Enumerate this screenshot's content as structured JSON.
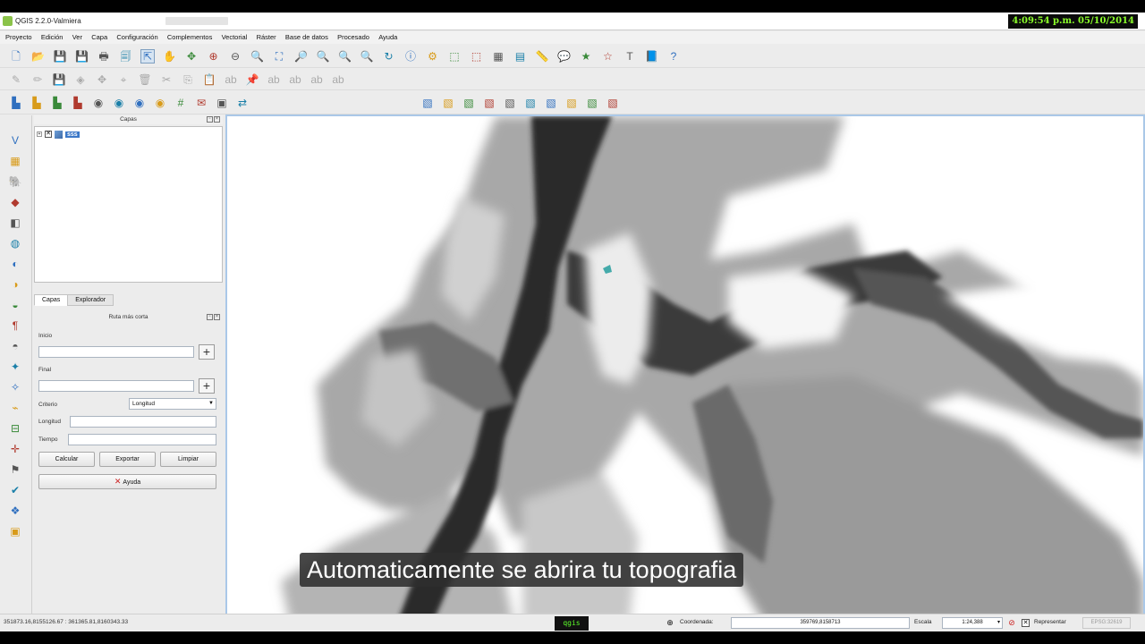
{
  "clock": "4:09:54 p.m. 05/10/2014",
  "window": {
    "title": "QGIS 2.2.0-Valmiera"
  },
  "menu": [
    "Proyecto",
    "Edición",
    "Ver",
    "Capa",
    "Configuración",
    "Complementos",
    "Vectorial",
    "Ráster",
    "Base de datos",
    "Procesado",
    "Ayuda"
  ],
  "layers_panel": {
    "title": "Capas",
    "layers": [
      {
        "name": "sss",
        "visible": true
      }
    ]
  },
  "tabs": [
    {
      "label": "Capas",
      "active": true
    },
    {
      "label": "Explorador",
      "active": false
    }
  ],
  "route_panel": {
    "title": "Ruta más corta",
    "start_label": "Inicio",
    "end_label": "Final",
    "criterion_label": "Criterio",
    "criterion_value": "Longitud",
    "length_label": "Longitud",
    "time_label": "Tiempo",
    "calculate": "Calcular",
    "export": "Exportar",
    "clear": "Limpiar",
    "help": "Ayuda"
  },
  "subtitle": "Automaticamente se abrira tu topografia",
  "status": {
    "coords_extent": "351873.16,8155126.67 : 361365.81,8160343.33",
    "badge": "qgis",
    "coordinate_label": "Coordenada:",
    "coordinate_value": "359769,8158713",
    "scale_label": "Escala",
    "scale_value": "1:24,388",
    "render_label": "Representar",
    "render_checked": true,
    "crs": "EPSG:32619"
  },
  "icons": {
    "toolbar1": [
      "new-project-icon",
      "open-project-icon",
      "save-project-icon",
      "save-as-icon",
      "new-print-composer-icon",
      "composer-manager-icon",
      "pan-map-icon",
      "pan-icon",
      "pan-to-selection-icon",
      "zoom-in-icon",
      "zoom-out-icon",
      "zoom-actual-icon",
      "zoom-full-icon",
      "zoom-to-selection-icon",
      "zoom-to-layer-icon",
      "zoom-last-icon",
      "zoom-next-icon",
      "refresh-icon",
      "identify-icon",
      "run-action-icon",
      "select-icon",
      "deselect-icon",
      "open-table-icon",
      "field-calc-icon",
      "measure-icon",
      "map-tips-icon",
      "bookmark-icon",
      "show-bookmarks-icon",
      "text-annotation-icon",
      "help-icon",
      "whats-this-icon"
    ],
    "toolbar2": [
      "edit-pencil-icon",
      "toggle-edit-icon",
      "save-edits-icon",
      "add-feature-icon",
      "move-feature-icon",
      "node-tool-icon",
      "delete-selected-icon",
      "cut-icon",
      "copy-icon",
      "paste-icon",
      "label-tool-icon",
      "pin-label-icon",
      "show-hide-label-icon",
      "move-label-icon",
      "rotate-label-icon",
      "change-label-icon"
    ],
    "toolbar3": [
      "raster-tool-icon",
      "raster-tool-icon",
      "raster-tool-icon",
      "raster-tool-icon",
      "georef-icon",
      "georef-icon",
      "georef-icon",
      "georef-icon",
      "grid-icon",
      "annotation-icon",
      "gps-icon",
      "route-icon"
    ],
    "toolbar3b": [
      "digitize-icon",
      "digitize-icon",
      "digitize-icon",
      "digitize-icon",
      "digitize-icon",
      "digitize-icon",
      "digitize-icon",
      "digitize-icon",
      "digitize-icon",
      "digitize-icon"
    ],
    "left": [
      "add-vector-layer-icon",
      "add-raster-layer-icon",
      "add-postgis-layer-icon",
      "add-spatialite-layer-icon",
      "add-mssql-layer-icon",
      "add-oracle-layer-icon",
      "add-wms-layer-icon",
      "add-wcs-layer-icon",
      "add-wfs-layer-icon",
      "add-delimited-text-icon",
      "add-virtual-layer-icon",
      "new-shapefile-icon",
      "new-spatialite-icon",
      "new-gpx-icon",
      "remove-layer-icon",
      "gps-tool-icon",
      "road-graph-icon",
      "geometry-checker-icon",
      "oracle-spatial-icon",
      "sql-icon"
    ]
  },
  "colors": {
    "clock_text": "#8bff2a",
    "map_border": "#aac8e8",
    "layer_highlight": "#3c78c8"
  }
}
